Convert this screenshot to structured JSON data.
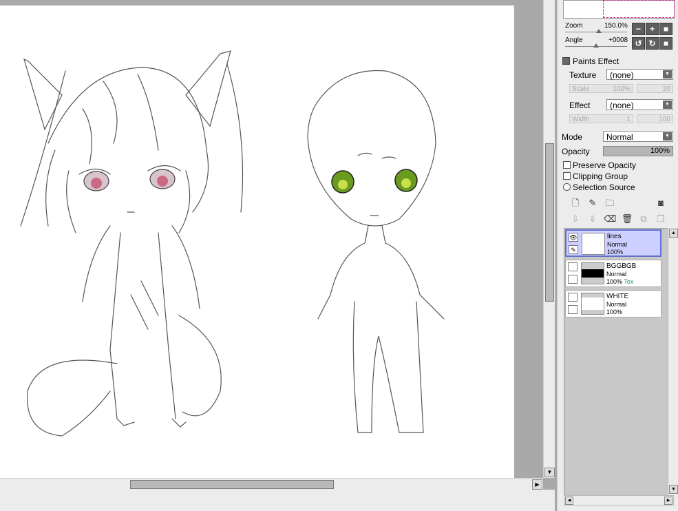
{
  "navigator": {
    "zoom_label": "Zoom",
    "zoom_value": "150.0%",
    "angle_label": "Angle",
    "angle_value": "+0008",
    "zoom_out_icon": "minus-icon",
    "zoom_in_icon": "plus-icon",
    "zoom_reset_icon": "square-icon",
    "rotate_ccw_icon": "rotate-ccw-icon",
    "rotate_cw_icon": "rotate-cw-icon",
    "rotate_reset_icon": "square-icon"
  },
  "paints_effect": {
    "title": "Paints Effect",
    "texture_label": "Texture",
    "texture_value": "(none)",
    "scale_label": "Scale",
    "scale_value": "100%",
    "scale_num": "20",
    "effect_label": "Effect",
    "effect_value": "(none)",
    "width_label": "Width",
    "width_value": "1",
    "width_num": "100"
  },
  "layer_props": {
    "mode_label": "Mode",
    "mode_value": "Normal",
    "opacity_label": "Opacity",
    "opacity_value": "100%",
    "opacity_fraction": 1.0,
    "preserve_opacity": "Preserve Opacity",
    "clipping_group": "Clipping Group",
    "selection_source": "Selection Source"
  },
  "layers": [
    {
      "name": "lines",
      "mode": "Normal",
      "opacity": "100%",
      "extra": "",
      "selected": true,
      "visible": true
    },
    {
      "name": "BGGBGB",
      "mode": "Normal",
      "opacity": "100%",
      "extra": "Tex",
      "selected": false,
      "visible": false
    },
    {
      "name": "WHITE",
      "mode": "Normal",
      "opacity": "100%",
      "extra": "",
      "selected": false,
      "visible": false
    }
  ],
  "colors": {
    "selected_layer_bg": "#cccfff",
    "selected_layer_border": "#6070d0",
    "texture_tag": "#2a8a78",
    "navigator_box": "#d0208a"
  }
}
